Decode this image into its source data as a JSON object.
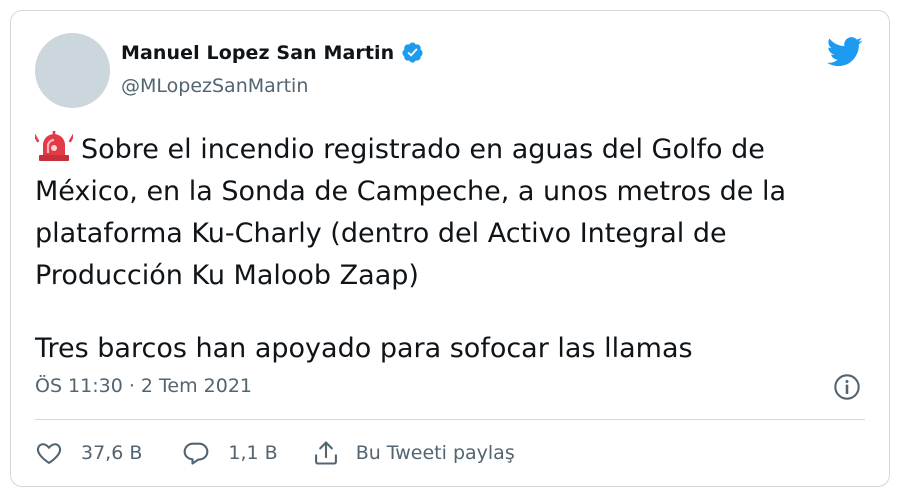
{
  "author": {
    "name": "Manuel Lopez San Martin",
    "handle": "@MLopezSanMartin",
    "verified": true
  },
  "tweet": {
    "lines": [
      "Sobre el incendio registrado en aguas del Golfo de",
      "México, en la Sonda de Campeche, a unos metros de la",
      "plataforma Ku-Charly (dentro del Activo Integral de",
      "Producción Ku Maloob Zaap)"
    ],
    "last_line": "Tres barcos han apoyado para sofocar las llamas",
    "emoji": "police-siren-icon"
  },
  "meta": {
    "timestamp": "ÖS 11:30 · 2 Tem 2021"
  },
  "actions": {
    "likes": "37,6 B",
    "replies": "1,1 B",
    "share_label": "Bu Tweeti paylaş"
  },
  "colors": {
    "twitter_blue": "#1d9bf0",
    "secondary_text": "#536471",
    "border": "#cfd9de",
    "avatar_placeholder": "#ccd6dd"
  }
}
